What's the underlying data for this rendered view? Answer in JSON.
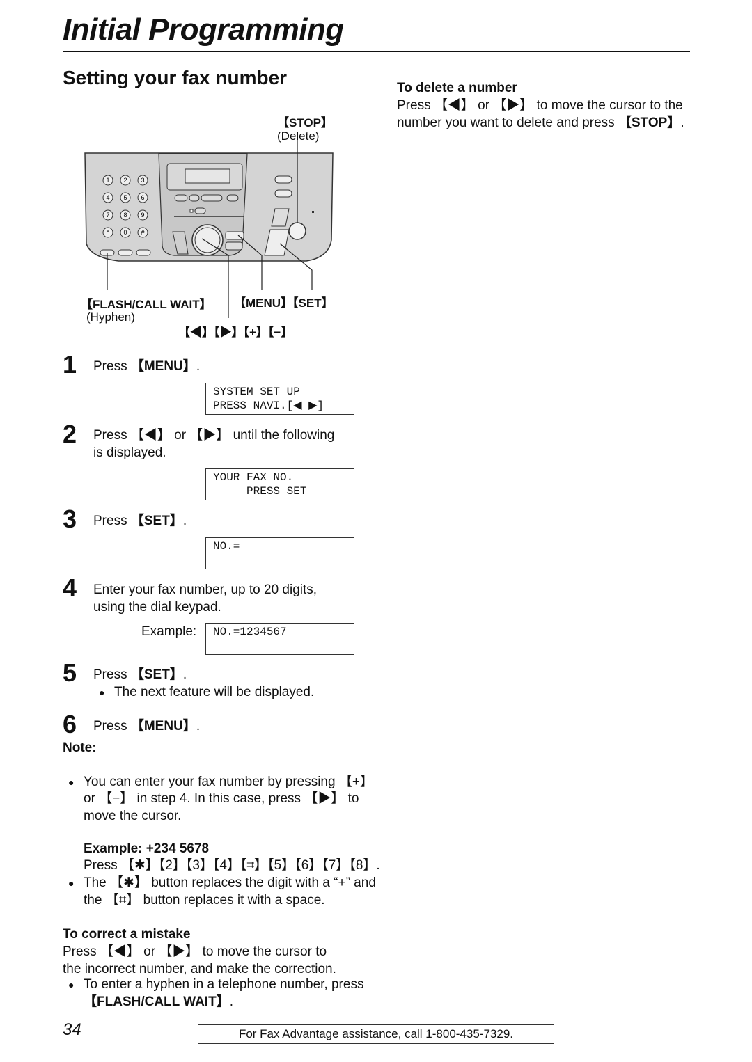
{
  "header": {
    "title": "Initial Programming"
  },
  "section": {
    "title": "Setting your fax number"
  },
  "diagram": {
    "stop_label": "【STOP】",
    "stop_sub": "(Delete)",
    "flash_label": "【FLASH/CALL WAIT】",
    "flash_sub": "(Hyphen)",
    "menu_set_label": "【MENU】【SET】",
    "nav_label": "【◀】【▶】【+】【−】",
    "keypad": [
      "1",
      "2",
      "3",
      "4",
      "5",
      "6",
      "7",
      "8",
      "9",
      "*",
      "0",
      "#"
    ]
  },
  "steps": [
    {
      "num": "1",
      "text_pre": "Press ",
      "key": "【MENU】",
      "text_post": ".",
      "lcd": "SYSTEM SET UP\nPRESS NAVI.[◀ ▶]"
    },
    {
      "num": "2",
      "text": "Press 【◀】 or 【▶】 until the following is displayed.",
      "lcd": "YOUR FAX NO.\n     PRESS SET"
    },
    {
      "num": "3",
      "text_pre": "Press ",
      "key": "【SET】",
      "text_post": ".",
      "lcd": "NO.="
    },
    {
      "num": "4",
      "text": "Enter your fax number, up to 20 digits, using the dial keypad.",
      "example_label": "Example:",
      "lcd": "NO.=1234567"
    },
    {
      "num": "5",
      "text_pre": "Press ",
      "key": "【SET】",
      "text_post": ".",
      "bullet": "The next feature will be displayed."
    },
    {
      "num": "6",
      "text_pre": "Press ",
      "key": "【MENU】",
      "text_post": "."
    }
  ],
  "note": {
    "heading": "Note:",
    "bullets": [
      "You can enter your fax number by pressing 【+】 or 【−】 in step 4. In this case, press 【▶】 to move the cursor.",
      "The 【✱】 button replaces the digit with a “+” and the 【⌗】 button replaces it with a space."
    ],
    "example_heading": "Example: +234 5678",
    "example_text": "Press 【✱】【2】【3】【4】【⌗】【5】【6】【7】【8】.",
    "bullet3_pre": "To enter a hyphen in a telephone number, press ",
    "bullet3_key": "【FLASH/CALL WAIT】",
    "bullet3_post": "."
  },
  "correct": {
    "heading": "To correct a mistake",
    "text": "Press 【◀】 or 【▶】 to move the cursor to the incorrect number, and make the correction."
  },
  "delete": {
    "heading": "To delete a number",
    "text_pre": "Press 【◀】 or 【▶】 to move the cursor to the number you want to delete and press ",
    "key": "【STOP】",
    "text_post": "."
  },
  "footer": {
    "page_number": "34",
    "assistance": "For Fax Advantage assistance, call 1-800-435-7329."
  }
}
